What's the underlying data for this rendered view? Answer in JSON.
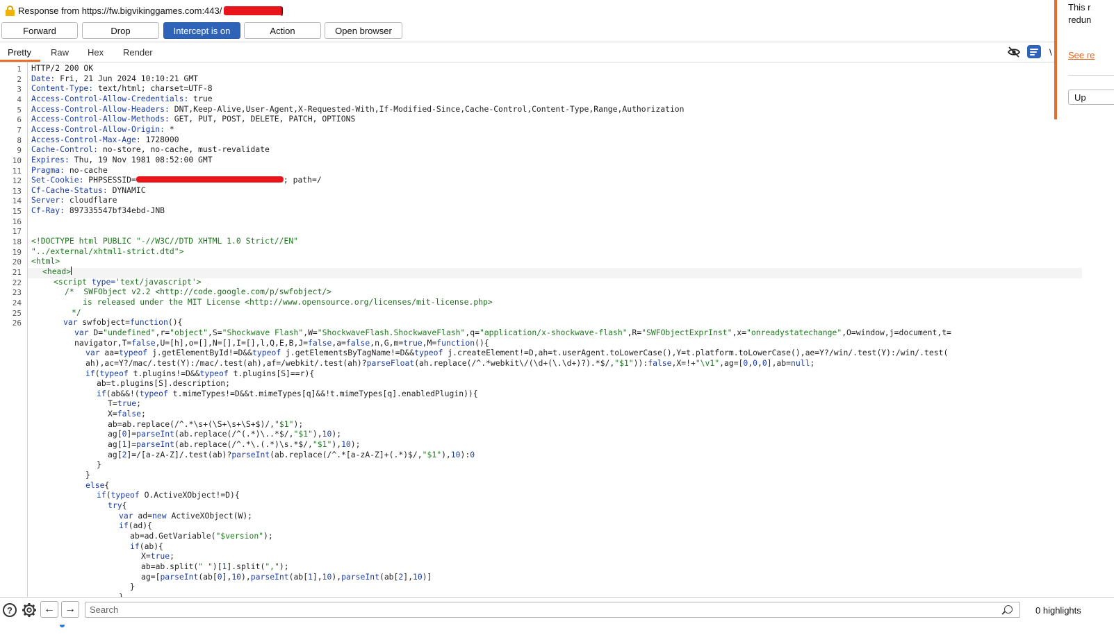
{
  "titlebar": {
    "title": "Response from https://fw.bigvikinggames.com:443/",
    "tail": "]"
  },
  "toolbar": {
    "forward": "Forward",
    "drop": "Drop",
    "intercept": "Intercept is on",
    "action": "Action",
    "open_browser": "Open browser"
  },
  "tabs": [
    "Pretty",
    "Raw",
    "Hex",
    "Render"
  ],
  "icons": {
    "hide_icon": "eye-slash-icon",
    "wrap_icon": "text-wrap-icon",
    "truncated_label": "\\"
  },
  "notification": {
    "line1": "This r",
    "line2": "redun",
    "link": "See re",
    "button": "Up"
  },
  "code": {
    "line_numbers": [
      "1",
      "2",
      "3",
      "4",
      "5",
      "6",
      "7",
      "8",
      "9",
      "10",
      "11",
      "12",
      "13",
      "14",
      "15",
      "16",
      "17",
      "18",
      "19",
      "20",
      "21",
      "22",
      "23",
      "24",
      "25",
      "26"
    ],
    "headers": [
      {
        "name": "HTTP/2 200 OK",
        "value": ""
      },
      {
        "name": "Date:",
        "value": " Fri, 21 Jun 2024 10:10:21 GMT"
      },
      {
        "name": "Content-Type:",
        "value": " text/html; charset=UTF-8"
      },
      {
        "name": "Access-Control-Allow-Credentials:",
        "value": " true"
      },
      {
        "name": "Access-Control-Allow-Headers:",
        "value": " DNT,Keep-Alive,User-Agent,X-Requested-With,If-Modified-Since,Cache-Control,Content-Type,Range,Authorization"
      },
      {
        "name": "Access-Control-Allow-Methods:",
        "value": " GET, PUT, POST, DELETE, PATCH, OPTIONS"
      },
      {
        "name": "Access-Control-Allow-Origin:",
        "value": " *"
      },
      {
        "name": "Access-Control-Max-Age:",
        "value": " 1728000"
      },
      {
        "name": "Cache-Control:",
        "value": " no-store, no-cache, must-revalidate"
      },
      {
        "name": "Expires:",
        "value": " Thu, 19 Nov 1981 08:52:00 GMT"
      },
      {
        "name": "Pragma:",
        "value": " no-cache"
      },
      {
        "name": "Set-Cookie:",
        "value": " PHPSESSID="
      },
      {
        "name": "Cf-Cache-Status:",
        "value": " DYNAMIC"
      },
      {
        "name": "Server:",
        "value": " cloudflare"
      },
      {
        "name": "Cf-Ray:",
        "value": " 897335547bf34ebd-JNB"
      }
    ],
    "cookie_tail": "; path=/",
    "doctype_line1": "<!DOCTYPE html PUBLIC \"-//W3C//DTD XHTML 1.0 Strict//EN\"",
    "doctype_line2": "\"../external/xhtml1-strict.dtd\">",
    "html_open": "<html>",
    "head_open": "<head>",
    "script_tag_open": "<script ",
    "script_attr": "type=",
    "script_attr_val": "'text/javascript'",
    "script_tag_close": ">",
    "comment1": "/*  SWFObject v2.2 <http://code.google.com/p/swfobject/>",
    "comment2": "is released under the MIT License <http://www.opensource.org/licenses/mit-license.php>",
    "comment3": "*/",
    "js": [
      "var swfobject=function(){",
      "var D=\"undefined\",r=\"object\",S=\"Shockwave Flash\",W=\"ShockwaveFlash.ShockwaveFlash\",q=\"application/x-shockwave-flash\",R=\"SWFObjectExprInst\",x=\"onreadystatechange\",O=window,j=document,t=",
      "navigator,T=false,U=[h],o=[],N=[],I=[],l,Q,E,B,J=false,a=false,n,G,m=true,M=function(){",
      "var aa=typeof j.getElementById!=D&&typeof j.getElementsByTagName!=D&&typeof j.createElement!=D,ah=t.userAgent.toLowerCase(),Y=t.platform.toLowerCase(),ae=Y?/win/.test(Y):/win/.test(",
      "ah),ac=Y?/mac/.test(Y):/mac/.test(ah),af=/webkit/.test(ah)?parseFloat(ah.replace(/^.*webkit\\/(\\d+(\\.\\d+)?).*$/,\"$1\")):false,X=!+\"\\v1\",ag=[0,0,0],ab=null;",
      "if(typeof t.plugins!=D&&typeof t.plugins[S]==r){",
      "ab=t.plugins[S].description;",
      "if(ab&&!(typeof t.mimeTypes!=D&&t.mimeTypes[q]&&!t.mimeTypes[q].enabledPlugin)){",
      "T=true;",
      "X=false;",
      "ab=ab.replace(/^.*\\s+(\\S+\\s+\\S+$)/,\"$1\");",
      "ag[0]=parseInt(ab.replace(/^(.*)\\..*$/,\"$1\"),10);",
      "ag[1]=parseInt(ab.replace(/^.*\\.(.*)\\s.*$/,\"$1\"),10);",
      "ag[2]=/[a-zA-Z]/.test(ab)?parseInt(ab.replace(/^.*[a-zA-Z]+(.*)$/,\"$1\"),10):0",
      "}",
      "}",
      "else{",
      "if(typeof O.ActiveXObject!=D){",
      "try{",
      "var ad=new ActiveXObject(W);",
      "if(ad){",
      "ab=ad.GetVariable(\"$version\");",
      "if(ab){",
      "X=true;",
      "ab=ab.split(\" \")[1].split(\",\");",
      "ag=[parseInt(ab[0],10),parseInt(ab[1],10),parseInt(ab[2],10)]",
      "}",
      "}"
    ]
  },
  "bottom": {
    "help": "?",
    "prev": "←",
    "next": "→",
    "search_placeholder": "Search",
    "highlights": "0 highlights"
  }
}
